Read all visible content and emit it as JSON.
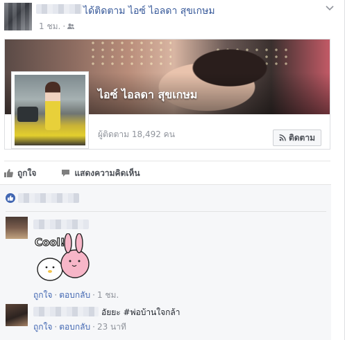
{
  "post": {
    "author_suffix": "ได้ติดตาม ไอซ์ ไอลดา สุขเกษม",
    "time": "1 ชม.",
    "audience_icon": "friends-icon",
    "menu_icon": "chevron-down-icon"
  },
  "page_card": {
    "name": "ไอซ์ ไอลดา สุขเกษม",
    "followers": "ผู้ติดตาม 18,492 คน",
    "follow_label": "ติดตาม",
    "follow_icon": "rss-icon"
  },
  "actions": {
    "like_label": "ถูกใจ",
    "comment_label": "แสดงความคิดเห็น"
  },
  "comments": [
    {
      "sticker_text": "Cool!",
      "like_label": "ถูกใจ",
      "reply_label": "ตอบกลับ",
      "time": "1 ชม."
    },
    {
      "text": "อัยยะ #พ่อบ้านใจกล้า",
      "like_label": "ถูกใจ",
      "reply_label": "ตอบกลับ",
      "time": "23 นาที"
    }
  ],
  "colors": {
    "link": "#365899",
    "action_link": "#4267b2",
    "meta": "#90949c",
    "comments_bg": "#f6f7f9"
  }
}
